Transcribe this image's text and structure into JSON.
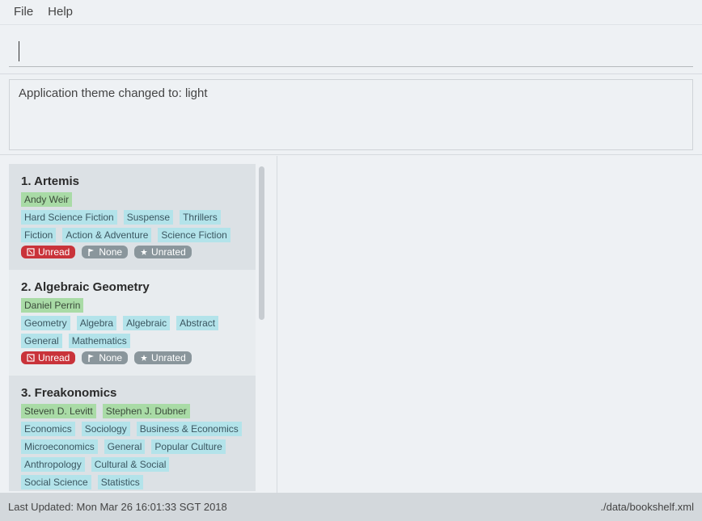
{
  "menu": {
    "file": "File",
    "help": "Help"
  },
  "command": {
    "value": "",
    "placeholder": ""
  },
  "result": {
    "message": "Application theme changed to: light"
  },
  "books": [
    {
      "title": "1. Artemis",
      "authors": [
        "Andy Weir"
      ],
      "categories": [
        "Hard Science Fiction",
        "Suspense",
        "Thrillers",
        "Fiction",
        "Action & Adventure",
        "Science Fiction"
      ],
      "status": "Unread",
      "priority": "None",
      "rating": "Unrated"
    },
    {
      "title": "2. Algebraic Geometry",
      "authors": [
        "Daniel Perrin"
      ],
      "categories": [
        "Geometry",
        "Algebra",
        "Algebraic",
        "Abstract",
        "General",
        "Mathematics"
      ],
      "status": "Unread",
      "priority": "None",
      "rating": "Unrated"
    },
    {
      "title": "3. Freakonomics",
      "authors": [
        "Steven D. Levitt",
        "Stephen J. Dubner"
      ],
      "categories": [
        "Economics",
        "Sociology",
        "Business & Economics",
        "Microeconomics",
        "General",
        "Popular Culture",
        "Anthropology",
        "Cultural & Social",
        "Social Science",
        "Statistics"
      ]
    }
  ],
  "statusbar": {
    "last_updated": "Last Updated: Mon Mar 26 16:01:33 SGT 2018",
    "file_path": "./data/bookshelf.xml"
  },
  "colors": {
    "author_bg": "#a9dba6",
    "category_bg": "#b3e3ea",
    "unread_bg": "#c9333a",
    "neutral_badge_bg": "#8a969c"
  },
  "icons": {
    "status": "book-icon",
    "priority": "flag-icon",
    "rating": "star-icon"
  }
}
